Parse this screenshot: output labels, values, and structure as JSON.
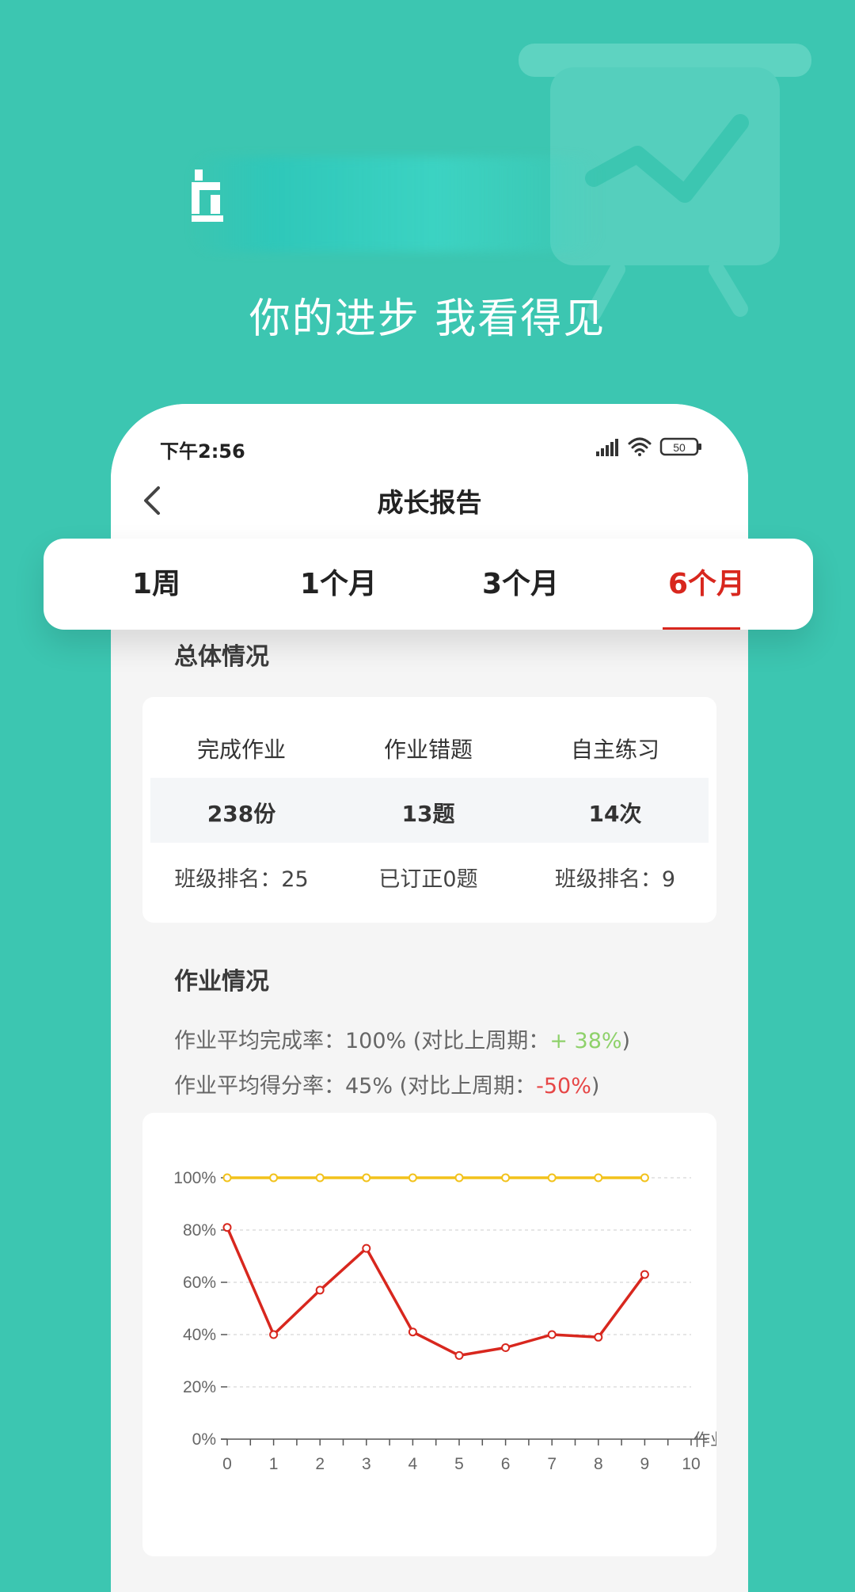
{
  "hero": {
    "slogan": "你的进步  我看得见"
  },
  "status_bar": {
    "time": "下午2:56",
    "battery": "50"
  },
  "nav": {
    "title": "成长报告"
  },
  "tabs": [
    {
      "label": "1周",
      "active": false
    },
    {
      "label": "1个月",
      "active": false
    },
    {
      "label": "3个月",
      "active": false
    },
    {
      "label": "6个月",
      "active": true
    }
  ],
  "overall": {
    "title": "总体情况",
    "columns": [
      {
        "head": "完成作业",
        "value": "238份",
        "sub": "班级排名：25"
      },
      {
        "head": "作业错题",
        "value": "13题",
        "sub": "已订正0题"
      },
      {
        "head": "自主练习",
        "value": "14次",
        "sub": "班级排名：9"
      }
    ]
  },
  "homework": {
    "title": "作业情况",
    "completion_label": "作业平均完成率：100%  (对比上周期：",
    "completion_delta": "+ 38%",
    "score_label": "作业平均得分率：45%   (对比上周期：",
    "score_delta": "-50%",
    "close_paren": ")"
  },
  "colors": {
    "background": "#3cc6b1",
    "accent_red": "#d8271e",
    "positive": "#8ed16a",
    "negative": "#e64646",
    "series_completion": "#f2c21b",
    "series_score": "#d8271e"
  },
  "chart_data": {
    "type": "line",
    "x": [
      0,
      1,
      2,
      3,
      4,
      5,
      6,
      7,
      8,
      9
    ],
    "x_ticks": [
      "0",
      "1",
      "2",
      "3",
      "4",
      "5",
      "6",
      "7",
      "8",
      "9",
      "10"
    ],
    "y_ticks": [
      "0%",
      "20%",
      "40%",
      "60%",
      "80%",
      "100%"
    ],
    "ylim": [
      0,
      100
    ],
    "xlim": [
      0,
      10
    ],
    "xlabel": "作业",
    "grid": true,
    "series": [
      {
        "values": [
          100,
          100,
          100,
          100,
          100,
          100,
          100,
          100,
          100,
          100
        ],
        "color": "#f2c21b"
      },
      {
        "values": [
          81,
          40,
          57,
          73,
          41,
          32,
          35,
          40,
          39,
          63
        ],
        "color": "#d8271e"
      }
    ]
  }
}
